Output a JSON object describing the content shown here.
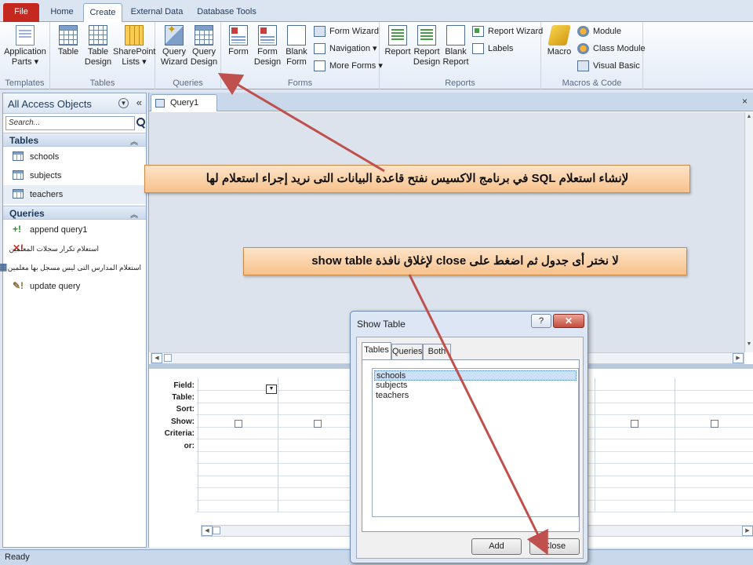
{
  "ribbon": {
    "tabs": [
      {
        "label": "File"
      },
      {
        "label": "Home"
      },
      {
        "label": "Create"
      },
      {
        "label": "External Data"
      },
      {
        "label": "Database Tools"
      }
    ],
    "groups": {
      "templates": {
        "label": "Templates",
        "application_parts": "Application\nParts ▾"
      },
      "tables": {
        "label": "Tables",
        "table": "Table",
        "table_design": "Table\nDesign",
        "sharepoint_lists": "SharePoint\nLists ▾"
      },
      "queries": {
        "label": "Queries",
        "query_wizard": "Query\nWizard",
        "query_design": "Query\nDesign"
      },
      "forms": {
        "label": "Forms",
        "form": "Form",
        "form_design": "Form\nDesign",
        "blank_form": "Blank\nForm",
        "form_wizard": "Form Wizard",
        "navigation": "Navigation ▾",
        "more_forms": "More Forms ▾"
      },
      "reports": {
        "label": "Reports",
        "report": "Report",
        "report_design": "Report\nDesign",
        "blank_report": "Blank\nReport",
        "report_wizard": "Report Wizard",
        "labels": "Labels"
      },
      "macros": {
        "label": "Macros & Code",
        "macro": "Macro",
        "module": "Module",
        "class_module": "Class Module",
        "visual_basic": "Visual Basic"
      }
    }
  },
  "nav": {
    "title": "All Access Objects",
    "search_placeholder": "Search...",
    "tables_header": "Tables",
    "tables": [
      "schools",
      "subjects",
      "teachers"
    ],
    "queries_header": "Queries",
    "queries": [
      "append query1",
      "استعلام تكرار سجلات المعلمين",
      "استعلام المدارس التى ليس مسجل بها معلمين",
      "update query"
    ]
  },
  "document": {
    "tab_label": "Query1",
    "close_glyph": "×",
    "grid_row_labels": [
      "Field:",
      "Table:",
      "Sort:",
      "Show:",
      "Criteria:",
      "or:"
    ]
  },
  "dialog": {
    "title": "Show Table",
    "help_glyph": "?",
    "close_glyph": "✕",
    "tabs": [
      "Tables",
      "Queries",
      "Both"
    ],
    "items": [
      "schools",
      "subjects",
      "teachers"
    ],
    "selected_item": "schools",
    "add_label": "Add",
    "close_label": "Close"
  },
  "status": {
    "text": "Ready"
  },
  "callouts": {
    "first": "لإنشاء استعلام SQL في برنامج الاكسيس نفتح قاعدة البيانات التى نريد إجراء استعلام لها",
    "second": "لا نختر أى جدول ثم اضغط على close لإغلاق نافذة show table"
  },
  "colors": {
    "accent": "#c4281f",
    "callout_fill": "#f7c28c",
    "arrow": "#c0504d"
  }
}
